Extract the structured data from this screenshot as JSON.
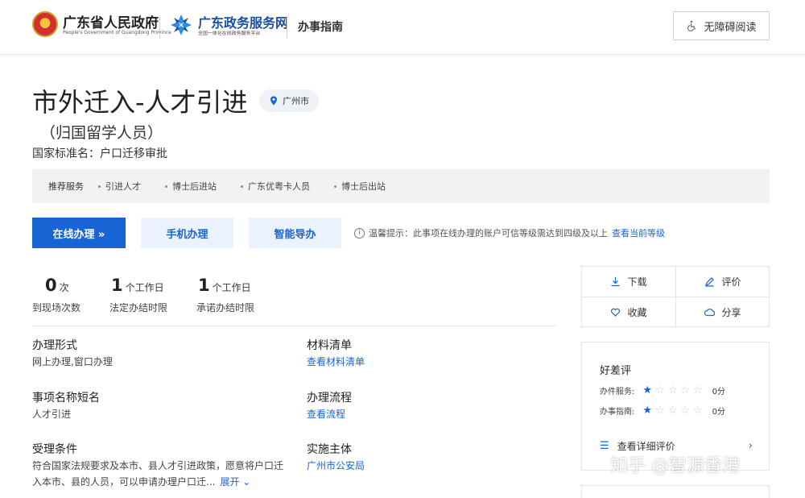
{
  "header": {
    "gov_name": "广东省人民政府",
    "gov_sub": "People's Government of Guangdong Province",
    "service_name": "广东政务服务网",
    "service_sub": "全国一体化在线政务服务平台",
    "section_title": "办事指南",
    "accessibility_label": "无障碍阅读"
  },
  "page": {
    "title": "市外迁入-人才引进",
    "city": "广州市",
    "subtitle": "（归国留学人员）",
    "standard_name": "国家标准名：户口迁移审批"
  },
  "recommend": {
    "label": "推荐服务",
    "items": [
      "引进人才",
      "博士后进站",
      "广东优粤卡人员",
      "博士后出站"
    ]
  },
  "actions": {
    "online": "在线办理 »",
    "mobile": "手机办理",
    "smart_guide": "智能导办",
    "tip_text": "温馨提示：此事项在线办理的账户可信等级需达到四级及以上",
    "tip_link": "查看当前等级"
  },
  "stats": [
    {
      "num": "0",
      "unit": "次",
      "label": "到现场次数"
    },
    {
      "num": "1",
      "unit": "个工作日",
      "label": "法定办结时限"
    },
    {
      "num": "1",
      "unit": "个工作日",
      "label": "承诺办结时限"
    }
  ],
  "info": {
    "form_h": "办理形式",
    "form_v": "网上办理,窗口办理",
    "materials_h": "材料清单",
    "materials_link": "查看材料清单",
    "short_name_h": "事项名称短名",
    "short_name_v": "人才引进",
    "process_h": "办理流程",
    "process_link": "查看流程",
    "conditions_h": "受理条件",
    "conditions_v": "符合国家法规要求及本市、县人才引进政策，愿意将户口迁入本市、县的人员，可以申请办理户口迁...",
    "expand": "展开 ⌄",
    "agency_h": "实施主体",
    "agency_link": "广州市公安局"
  },
  "tools": {
    "download": "下载",
    "evaluate": "评价",
    "favorite": "收藏",
    "share": "分享"
  },
  "rating": {
    "title": "好差评",
    "service_label": "办件服务:",
    "service_stars": 1,
    "service_score": "0分",
    "guide_label": "办事指南:",
    "guide_stars": 1,
    "guide_score": "0分",
    "detail_link": "查看详细评价"
  },
  "watermark": "知乎 @智源香港"
}
